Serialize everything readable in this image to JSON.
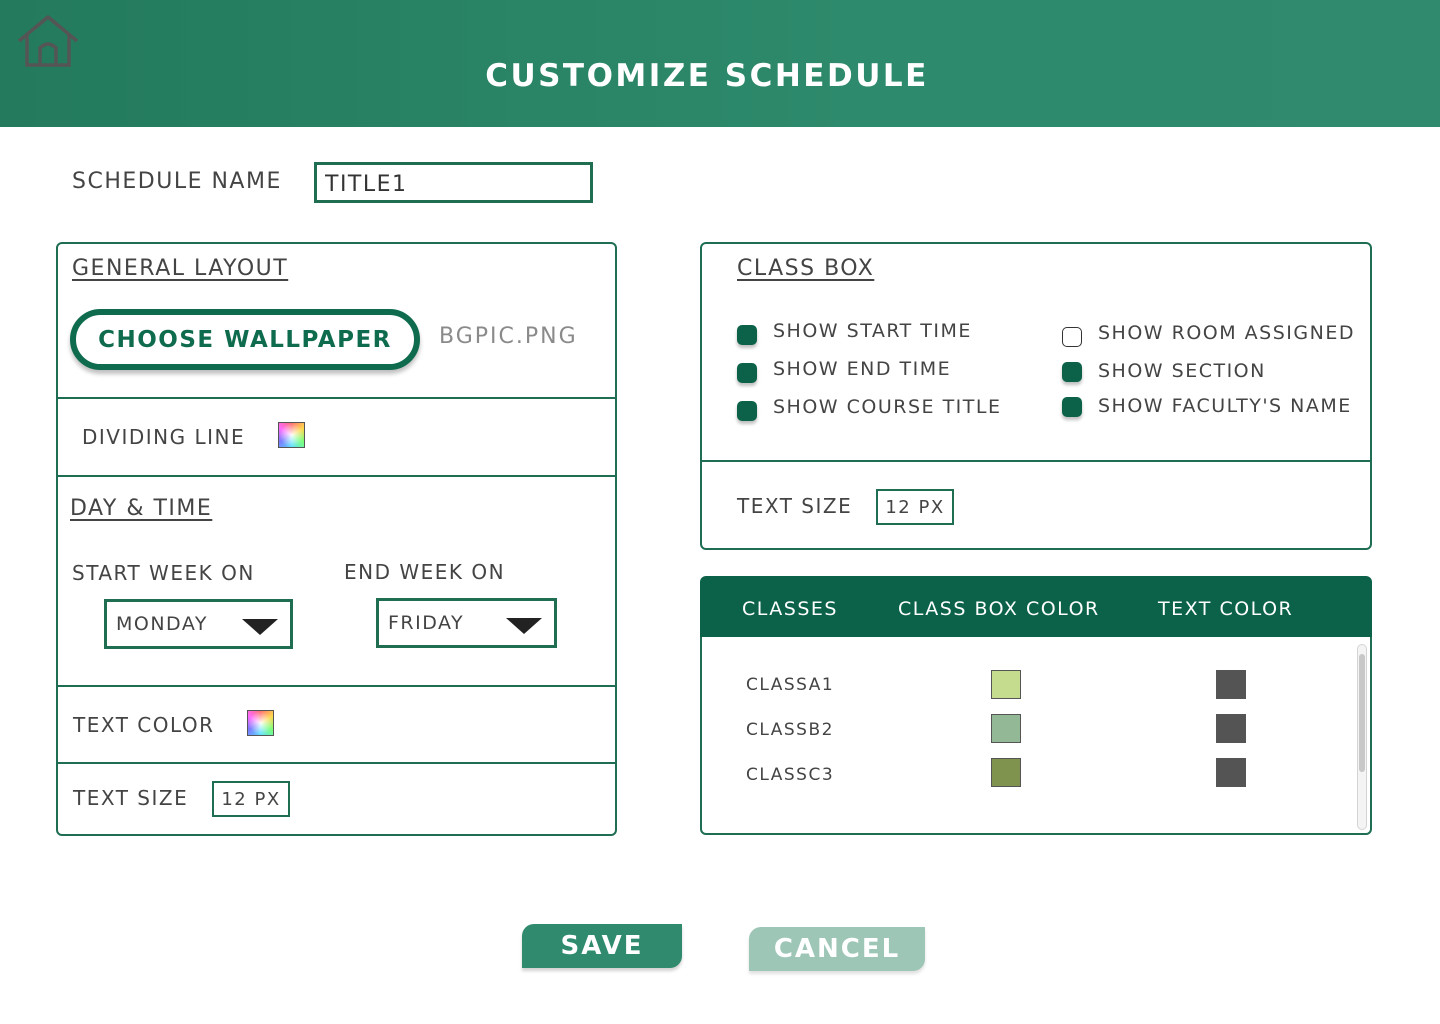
{
  "header": {
    "title": "CUSTOMIZE SCHEDULE",
    "home_icon": "home-icon"
  },
  "schedule_name": {
    "label": "SCHEDULE NAME",
    "value": "TITLE1"
  },
  "general_layout": {
    "title": "GENERAL LAYOUT",
    "choose_wallpaper_label": "CHOOSE WALLPAPER",
    "wallpaper_file": "BGPIC.PNG",
    "dividing_line_label": "DIVIDING LINE"
  },
  "day_time": {
    "title": "DAY & TIME",
    "start_week_label": "START WEEK ON",
    "start_week_value": "MONDAY",
    "end_week_label": "END WEEK ON",
    "end_week_value": "FRIDAY",
    "text_color_label": "TEXT COLOR",
    "text_size_label": "TEXT SIZE",
    "text_size_value": "12 PX"
  },
  "class_box": {
    "title": "CLASS BOX",
    "options": [
      {
        "label": "SHOW START TIME",
        "checked": true
      },
      {
        "label": "SHOW END TIME",
        "checked": true
      },
      {
        "label": "SHOW COURSE TITLE",
        "checked": true
      },
      {
        "label": "SHOW ROOM ASSIGNED",
        "checked": false
      },
      {
        "label": "SHOW SECTION",
        "checked": true
      },
      {
        "label": "SHOW FACULTY'S NAME",
        "checked": true
      }
    ],
    "text_size_label": "TEXT SIZE",
    "text_size_value": "12 PX"
  },
  "classes_table": {
    "headers": [
      "CLASSES",
      "CLASS BOX COLOR",
      "TEXT COLOR"
    ],
    "rows": [
      {
        "name": "CLASSA1",
        "box_color": "#c5dc8f",
        "text_color": "#545454"
      },
      {
        "name": "CLASSB2",
        "box_color": "#93b896",
        "text_color": "#545454"
      },
      {
        "name": "CLASSC3",
        "box_color": "#7f924e",
        "text_color": "#545454"
      }
    ]
  },
  "actions": {
    "save_label": "SAVE",
    "cancel_label": "CANCEL"
  },
  "colors": {
    "primary": "#0c6249",
    "header": "#2e8a6c",
    "cancel": "#9dc6b7"
  }
}
